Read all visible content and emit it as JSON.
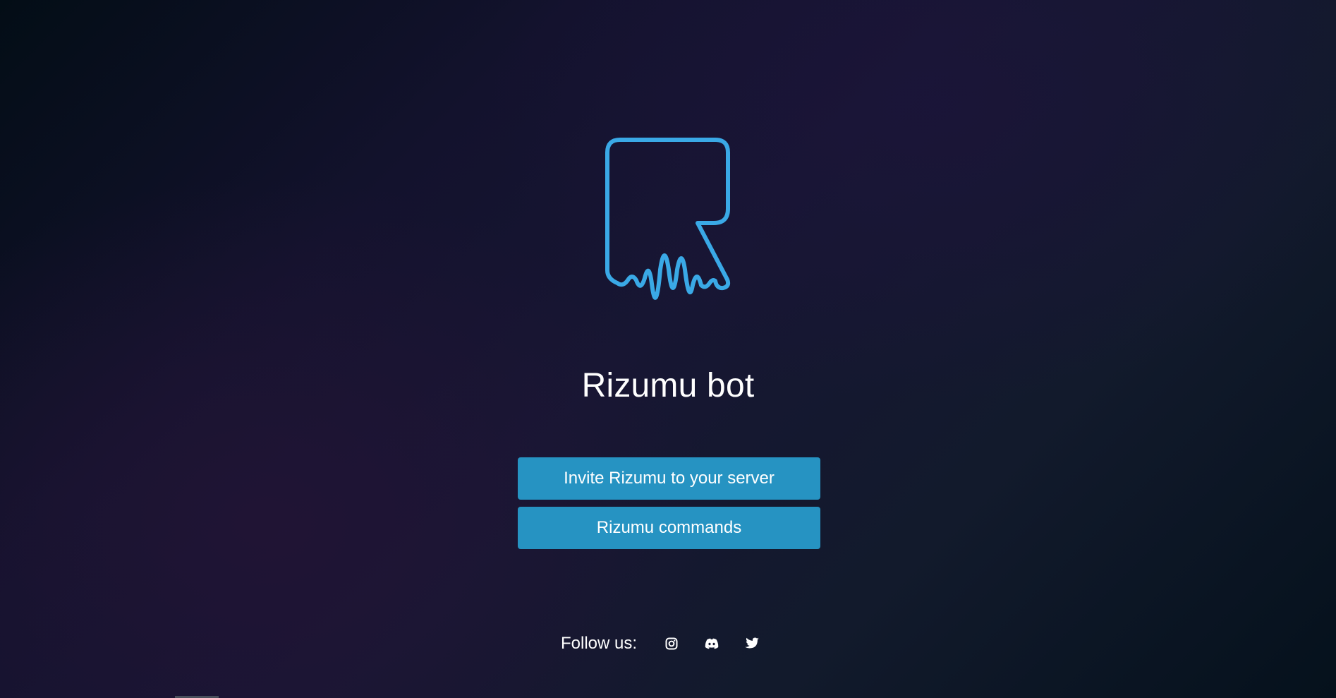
{
  "page": {
    "title": "Rizumu bot"
  },
  "logo": {
    "icon": "rizumu-r-soundwave-logo",
    "color": "#3aa9e6"
  },
  "buttons": {
    "invite_label": "Invite Rizumu to your server",
    "commands_label": "Rizumu commands",
    "color": "#2693c2"
  },
  "footer": {
    "follow_label": "Follow us:",
    "social": [
      {
        "icon": "instagram-icon"
      },
      {
        "icon": "discord-icon"
      },
      {
        "icon": "twitter-icon"
      }
    ]
  }
}
